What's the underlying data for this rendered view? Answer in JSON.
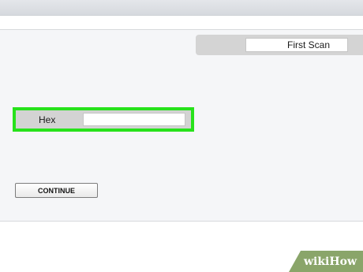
{
  "scan": {
    "first_scan_label": "First Scan"
  },
  "value_type": {
    "label": "Hex",
    "value": ""
  },
  "continue": {
    "label": "CONTINUE"
  },
  "watermark": {
    "wiki": "wiki",
    "how": "How"
  },
  "colors": {
    "highlight": "#27e21b",
    "badge": "#8aa56a"
  }
}
